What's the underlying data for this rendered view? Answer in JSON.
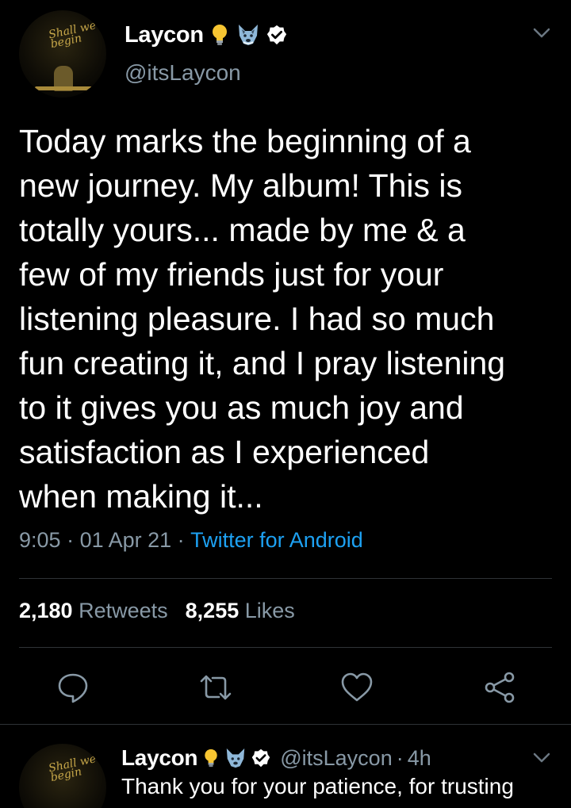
{
  "tweet": {
    "author_name": "Laycon",
    "author_handle": "@itsLaycon",
    "avatar_script": "Shall we begin",
    "text": "Today marks the beginning of a\nnew journey. My album! This is\ntotally yours... made by me & a\nfew of my friends just for your\nlistening pleasure. I had so much\nfun creating it, and I pray listening\nto it gives you as much joy and\nsatisfaction as I experienced\nwhen making it...",
    "time": "9:05",
    "separator": " · ",
    "date": "01 Apr 21",
    "source": "Twitter for Android",
    "retweets_count": "2,180",
    "retweets_label": "Retweets",
    "likes_count": "8,255",
    "likes_label": "Likes"
  },
  "reply": {
    "author_name": "Laycon",
    "author_handle": "@itsLaycon",
    "separator": "·",
    "time": "4h",
    "text": "Thank you for your patience, for trusting"
  },
  "icons": {
    "name_badges": [
      "lightbulb-icon",
      "wolf-icon",
      "verified-badge-icon"
    ],
    "menu": "chevron-down-icon",
    "actions": [
      "reply-icon",
      "retweet-icon",
      "like-icon",
      "share-icon"
    ]
  },
  "colors": {
    "background": "#000000",
    "text": "#ffffff",
    "secondary_text": "#8899a6",
    "link": "#1da1f2",
    "divider": "#2f3336",
    "lightbulb": "#f7c531",
    "wolf": "#8fb8d9"
  }
}
